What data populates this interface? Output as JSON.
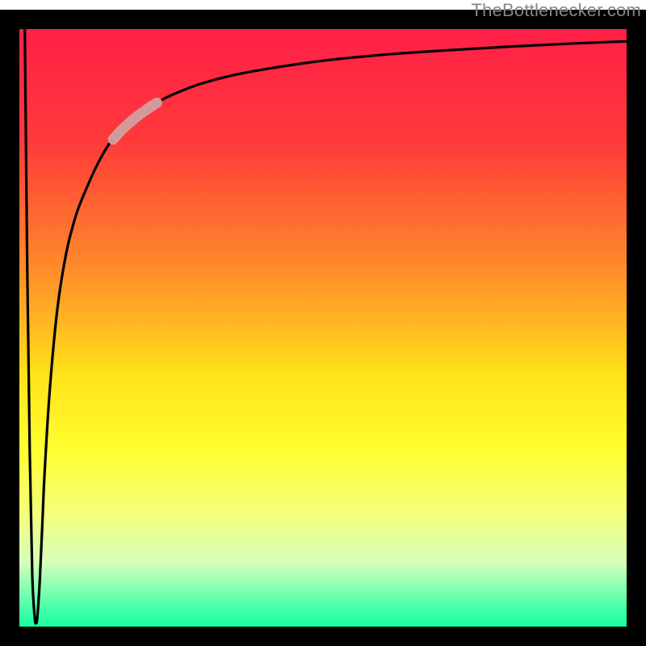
{
  "attribution": "TheBottlenecker.com",
  "chart_data": {
    "type": "line",
    "title": "",
    "xlabel": "",
    "ylabel": "",
    "xlim": [
      0,
      100
    ],
    "ylim": [
      0,
      100
    ],
    "grid": false,
    "axes_visible": false,
    "background_gradient": {
      "stops": [
        {
          "pos": 0.0,
          "color": "#ff1d48"
        },
        {
          "pos": 0.2,
          "color": "#ff3a3a"
        },
        {
          "pos": 0.4,
          "color": "#ff8a2a"
        },
        {
          "pos": 0.58,
          "color": "#ffe31a"
        },
        {
          "pos": 0.7,
          "color": "#ffff30"
        },
        {
          "pos": 0.8,
          "color": "#f4ff7a"
        },
        {
          "pos": 0.88,
          "color": "#d6ffba"
        },
        {
          "pos": 0.96,
          "color": "#3dffa8"
        },
        {
          "pos": 1.0,
          "color": "#00ff9d"
        }
      ]
    },
    "series": [
      {
        "name": "bottleneck-curve",
        "x": [
          2.4,
          2.8,
          3.2,
          3.6,
          4.0,
          4.2,
          4.4,
          4.8,
          5.2,
          5.6,
          6.4,
          7.6,
          9.0,
          10.5,
          12.0,
          14.0,
          16.0,
          18.0,
          20.0,
          22.0,
          24.0,
          26.0,
          30.0,
          35.0,
          40.0,
          50.0,
          60.0,
          70.0,
          80.0,
          90.0,
          100.0
        ],
        "y": [
          100.0,
          60.0,
          30.0,
          10.0,
          3.0,
          2.2,
          3.0,
          9.0,
          18.0,
          27.0,
          40.0,
          53.0,
          62.0,
          68.0,
          72.0,
          76.5,
          80.0,
          82.2,
          84.0,
          85.5,
          86.8,
          87.8,
          89.4,
          90.8,
          91.8,
          93.3,
          94.3,
          95.0,
          95.6,
          96.1,
          96.5
        ]
      }
    ],
    "highlight_segment": {
      "series": "bottleneck-curve",
      "x_range": [
        16.5,
        23.5
      ]
    }
  }
}
